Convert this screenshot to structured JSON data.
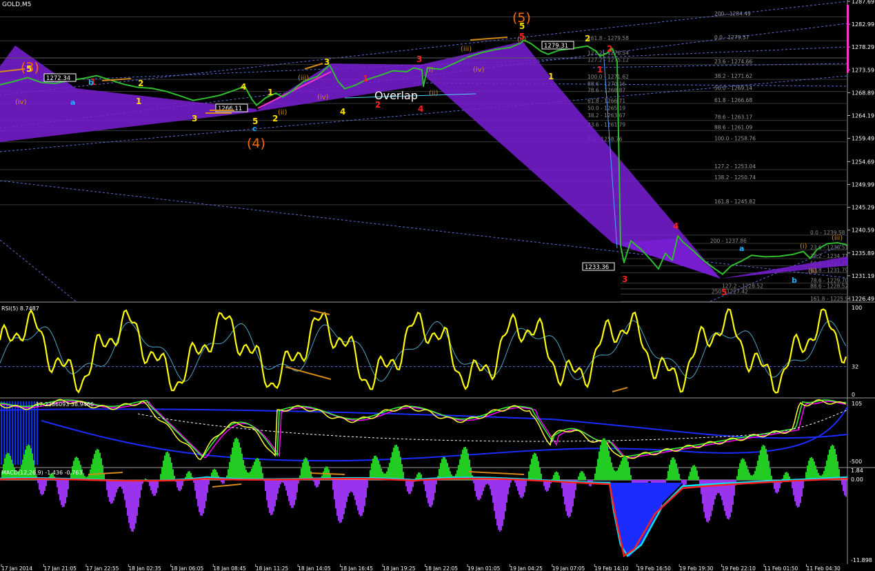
{
  "colors": {
    "background": "#000000",
    "price_line": "#2fbf2f",
    "purple_fill": "#7a1fd6",
    "fib_line": "#4a4a4a",
    "trend_dash": "#5c6fd8",
    "rsi_line": "#ffff00",
    "macd_up": "#22cc22",
    "macd_down": "#9933ee",
    "signal_red": "#ff2020",
    "signal_cyan": "#00e5ff",
    "wave_yellow": "#ffe000",
    "wave_red": "#ff2020",
    "wave_orange": "#ff6a00",
    "wave_tan": "#d38a1a",
    "wave_cyan": "#18b5ff",
    "magenta_bar": "#ff33cc"
  },
  "header": {
    "symbol": "GOLD,M5"
  },
  "chart_data": [
    {
      "type": "line",
      "name": "main-price-chart",
      "ylim": [
        1226.49,
        1287.69
      ],
      "y_ticks": [
        "1287.69",
        "1282.99",
        "1278.29",
        "1273.59",
        "1268.89",
        "1264.19",
        "1259.49",
        "1254.69",
        "1249.99",
        "1245.29",
        "1240.59",
        "1235.89",
        "1231.19",
        "1226.49"
      ],
      "price_points": [
        [
          0,
          1270.5
        ],
        [
          20,
          1271.2
        ],
        [
          40,
          1272.0
        ],
        [
          60,
          1271.0
        ],
        [
          80,
          1270.8
        ],
        [
          100,
          1271.4
        ],
        [
          120,
          1271.8
        ],
        [
          140,
          1272.4
        ],
        [
          160,
          1271.5
        ],
        [
          180,
          1270.6
        ],
        [
          200,
          1270.0
        ],
        [
          220,
          1269.8
        ],
        [
          240,
          1269.2
        ],
        [
          260,
          1268.3
        ],
        [
          280,
          1267.3
        ],
        [
          300,
          1267.8
        ],
        [
          320,
          1268.4
        ],
        [
          340,
          1269.4
        ],
        [
          355,
          1270.2
        ],
        [
          365,
          1267.6
        ],
        [
          372,
          1266.3
        ],
        [
          385,
          1267.8
        ],
        [
          400,
          1268.8
        ],
        [
          410,
          1268.0
        ],
        [
          425,
          1269.4
        ],
        [
          440,
          1271.2
        ],
        [
          460,
          1272.2
        ],
        [
          478,
          1274.6
        ],
        [
          490,
          1271.3
        ],
        [
          500,
          1269.7
        ],
        [
          515,
          1270.4
        ],
        [
          530,
          1271.5
        ],
        [
          550,
          1272.4
        ],
        [
          570,
          1273.4
        ],
        [
          590,
          1273.2
        ],
        [
          600,
          1274.0
        ],
        [
          612,
          1273.6
        ],
        [
          614,
          1270.2
        ],
        [
          620,
          1274.0
        ],
        [
          640,
          1273.7
        ],
        [
          660,
          1275.0
        ],
        [
          680,
          1276.3
        ],
        [
          700,
          1277.2
        ],
        [
          720,
          1277.8
        ],
        [
          740,
          1278.2
        ],
        [
          755,
          1279.1
        ],
        [
          760,
          1279.7
        ],
        [
          770,
          1279.0
        ],
        [
          785,
          1277.4
        ],
        [
          795,
          1276.8
        ],
        [
          810,
          1277.6
        ],
        [
          830,
          1278.0
        ],
        [
          852,
          1278.5
        ],
        [
          865,
          1277.4
        ],
        [
          870,
          1276.4
        ],
        [
          880,
          1277.0
        ],
        [
          888,
          1278.0
        ],
        [
          895,
          1275.4
        ],
        [
          900,
          1237.4
        ],
        [
          905,
          1233.9
        ],
        [
          915,
          1238.4
        ],
        [
          930,
          1236.6
        ],
        [
          945,
          1234.3
        ],
        [
          955,
          1232.6
        ],
        [
          965,
          1235.8
        ],
        [
          975,
          1234.4
        ],
        [
          983,
          1239.4
        ],
        [
          990,
          1238.2
        ],
        [
          1005,
          1236.4
        ],
        [
          1020,
          1234.4
        ],
        [
          1035,
          1232.8
        ],
        [
          1048,
          1231.5
        ],
        [
          1060,
          1233.2
        ],
        [
          1075,
          1234.2
        ],
        [
          1090,
          1235.4
        ],
        [
          1110,
          1235.1
        ],
        [
          1130,
          1235.2
        ],
        [
          1150,
          1235.6
        ],
        [
          1165,
          1236.2
        ],
        [
          1175,
          1234.8
        ],
        [
          1185,
          1236.6
        ],
        [
          1200,
          1237.8
        ],
        [
          1215,
          1238.0
        ],
        [
          1229,
          1237.5
        ]
      ],
      "last_price_markers": [
        {
          "label": "1279.31",
          "price": 1279.31
        },
        {
          "label": "1272.34",
          "price": 1272.34
        },
        {
          "label": "1266.11",
          "price": 1266.11
        },
        {
          "label": "1233.36",
          "price": 1233.36
        }
      ],
      "fib_labels_upper": [
        "200 - 1284.49",
        "0.0 - 1279.57",
        "23.6 - 1274.66",
        "38.2 - 1271.62",
        "50.0 - 1269.14",
        "61.8 - 1266.68",
        "78.6 - 1263.17",
        "88.6 - 1261.09",
        "100.0 - 1258.76",
        "127.2 - 1253.04",
        "138.2 - 1250.74",
        "161.8 - 1245.82"
      ],
      "fib_labels_mid": [
        "161.8 - 1279.58",
        "127.2 - 1276.54",
        "127.2 - 1275.12",
        "100.0 - 1271.62",
        "88.6 - 1270.16",
        "78.6 - 1268.87",
        "61.8 - 1266.71",
        "50.0 - 1265.19",
        "38.2 - 1263.67",
        "23.6 - 1261.79",
        "0.0 - 1258.76"
      ],
      "fib_labels_lower": [
        "0.0 - 1239.58",
        "200 - 1237.86",
        "23.6 - 1236.51",
        "38.2 - 1234.71",
        "50.0 - 1233.25",
        "61.8 - 1231.79",
        "78.6 - 1229.70",
        "88.6 - 1228.52",
        "127.2 - 1228.52",
        "161.8 - 1225.91",
        "250 - 1227.42"
      ],
      "annotations": {
        "overlap": "Overlap",
        "wave_labels": [
          "(3)",
          "(4)",
          "(5)",
          "(iv)",
          "(iii)",
          "(iv)",
          "(i)",
          "(ii)",
          "(iii)",
          "(iv)",
          "(ii)",
          "(i)",
          "(ii)",
          "(iii)",
          "(ii)",
          "1",
          "2",
          "3",
          "4",
          "5",
          "a",
          "b",
          "c"
        ]
      }
    },
    {
      "type": "line",
      "name": "rsi",
      "title": "RSI(5) 8.7487",
      "ylim": [
        0,
        100
      ],
      "y_ticks": [
        "100",
        "32",
        "0"
      ]
    },
    {
      "type": "line",
      "name": "stochastic-bands",
      "title": "17 2386093 38.9466",
      "y_ticks": [
        "105",
        "-500"
      ]
    },
    {
      "type": "bar",
      "name": "macd",
      "title": "MACD(12,26,9) -1.436 -0.763",
      "y_ticks": [
        "1.84",
        "0.00",
        "-11.898"
      ]
    }
  ],
  "time_axis": [
    "17 Jan 2014",
    "17 Jan 21:05",
    "17 Jan 22:55",
    "18 Jan 02:35",
    "18 Jan 06:05",
    "18 Jan 08:45",
    "18 Jan 11:25",
    "18 Jan 14:05",
    "18 Jan 16:45",
    "18 Jan 19:25",
    "18 Jan 22:05",
    "19 Jan 01:05",
    "19 Jan 04:25",
    "19 Jan 07:05",
    "19 Feb 14:10",
    "19 Feb 16:50",
    "19 Feb 19:30",
    "19 Feb 22:10",
    "11 Feb 01:50",
    "11 Feb 04:30"
  ]
}
